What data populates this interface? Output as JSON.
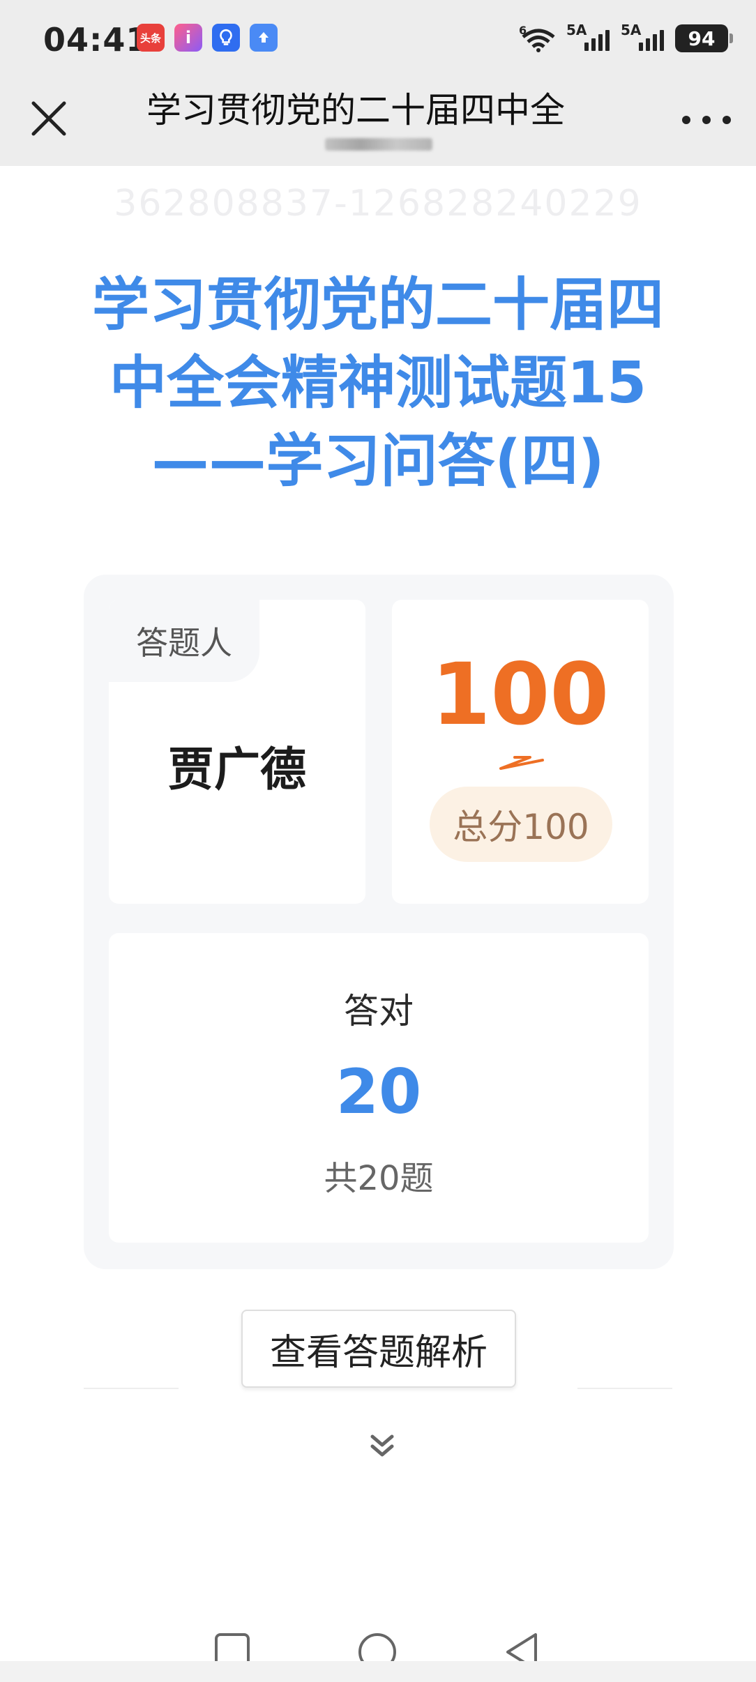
{
  "status_bar": {
    "time": "04:41",
    "app_icons": [
      {
        "name": "toutiao-icon",
        "text": "头条"
      },
      {
        "name": "info-icon",
        "text": "i"
      },
      {
        "name": "bulb-icon",
        "text": "💡"
      },
      {
        "name": "upload-icon",
        "text": "⬆"
      }
    ],
    "wifi_label": "6",
    "signal1_label": "5A",
    "signal2_label": "5A",
    "battery": "94"
  },
  "title_bar": {
    "title": "学习贯彻党的二十届四中全",
    "close_icon": "close-icon",
    "more_icon": "more-icon"
  },
  "watermark": "362808837-126828240229",
  "quiz": {
    "title_lines": [
      "学习贯彻党的二十届四",
      "中全会精神测试题15",
      "——学习问答(四)"
    ]
  },
  "result": {
    "respondent_label": "答题人",
    "respondent_name": "贾广德",
    "score": "100",
    "total_score": "总分100",
    "correct_label": "答对",
    "correct_count": "20",
    "total_questions": "共20题"
  },
  "actions": {
    "review_button": "查看答题解析"
  },
  "colors": {
    "accent_blue": "#3f8ae8",
    "score_orange": "#ee6f24",
    "badge_bg": "#fcf1e4"
  }
}
